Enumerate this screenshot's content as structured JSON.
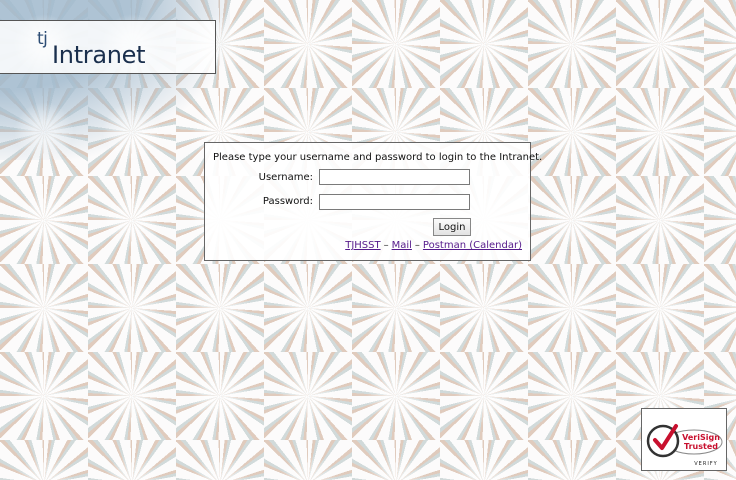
{
  "logo": {
    "tj": "tj",
    "name": "Intranet"
  },
  "login": {
    "prompt": "Please type your username and password to login to the Intranet.",
    "username_label": "Username:",
    "password_label": "Password:",
    "username_value": "",
    "password_value": "",
    "button_label": "Login",
    "links": [
      {
        "label": "TJHSST"
      },
      {
        "label": "Mail"
      },
      {
        "label": "Postman (Calendar)"
      }
    ],
    "separator": "–"
  },
  "badge": {
    "icon": "verisign-check-icon",
    "line1": "VeriSign",
    "line2": "Trusted",
    "verify": "VERIFY",
    "accent_color": "#c8102e"
  }
}
